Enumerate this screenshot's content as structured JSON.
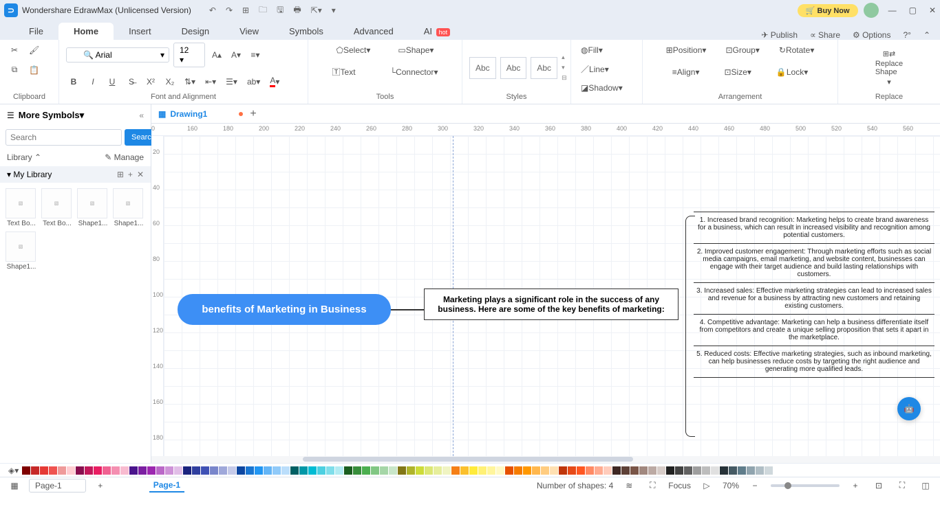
{
  "app": {
    "title": "Wondershare EdrawMax (Unlicensed Version)",
    "buy": "Buy Now"
  },
  "menu": {
    "file": "File",
    "home": "Home",
    "insert": "Insert",
    "design": "Design",
    "view": "View",
    "symbols": "Symbols",
    "advanced": "Advanced",
    "ai": "AI",
    "hot": "hot",
    "publish": "Publish",
    "share": "Share",
    "options": "Options"
  },
  "ribbon": {
    "clipboard": "Clipboard",
    "font_name": "Arial",
    "font_size": "12",
    "font_align": "Font and Alignment",
    "select": "Select",
    "shape": "Shape",
    "text": "Text",
    "connector": "Connector",
    "tools": "Tools",
    "abc": "Abc",
    "styles": "Styles",
    "fill": "Fill",
    "line": "Line",
    "shadow": "Shadow",
    "position": "Position",
    "group": "Group",
    "rotate": "Rotate",
    "align": "Align",
    "size": "Size",
    "lock": "Lock",
    "arrangement": "Arrangement",
    "replace_shape": "Replace\nShape",
    "replace": "Replace"
  },
  "sidebar": {
    "more": "More Symbols",
    "search_ph": "Search",
    "search_btn": "Search",
    "library": "Library",
    "manage": "Manage",
    "mylib": "My Library",
    "shapes": [
      "Text Bo...",
      "Text Bo...",
      "Shape1...",
      "Shape1...",
      "Shape1..."
    ]
  },
  "doc": {
    "tab": "Drawing1",
    "add": "+"
  },
  "ruler_h": [
    "0",
    "160",
    "180",
    "200",
    "220",
    "240",
    "260",
    "280",
    "300",
    "320",
    "340",
    "360",
    "380",
    "400",
    "420",
    "440",
    "460",
    "480",
    "500",
    "520",
    "540",
    "560"
  ],
  "ruler_v": [
    "20",
    "40",
    "60",
    "80",
    "100",
    "120",
    "140",
    "160",
    "180"
  ],
  "shapes": {
    "main": "benefits of Marketing in Business",
    "desc": "Marketing plays a significant role in the success of any business. Here are some of the key benefits of marketing:",
    "benefits": [
      "1. Increased brand recognition: Marketing helps to create brand awareness for a business, which can result in increased visibility and recognition among potential customers.",
      "2. Improved customer engagement: Through marketing efforts such as social media campaigns, email marketing, and website content, businesses can engage with their target audience and build lasting relationships with customers.",
      "3. Increased sales: Effective marketing strategies can lead to increased sales and revenue for a business by attracting new customers and retaining existing customers.",
      "4. Competitive advantage: Marketing can help a business differentiate itself from competitors and create a unique selling proposition that sets it apart in the marketplace.",
      "5. Reduced costs: Effective marketing strategies, such as inbound marketing, can help businesses reduce costs by targeting the right audience and generating more qualified leads."
    ]
  },
  "status": {
    "page_sel": "Page-1",
    "page_tab": "Page-1",
    "shape_count": "Number of shapes: 4",
    "focus": "Focus",
    "zoom": "70%"
  }
}
